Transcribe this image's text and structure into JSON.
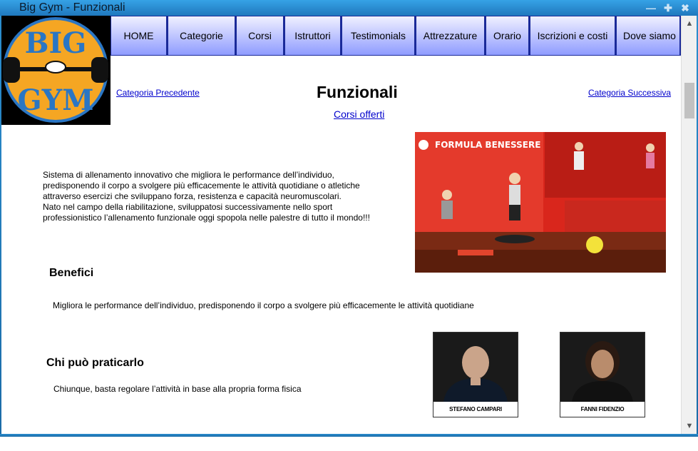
{
  "window": {
    "title": "Big Gym - Funzionali",
    "buttons": [
      "minimize",
      "maximize",
      "close"
    ]
  },
  "logo": {
    "alt": "BIG GYM logo",
    "top_text": "BIG",
    "bottom_text": "GYM"
  },
  "nav": [
    {
      "label": "HOME"
    },
    {
      "label": "Categorie"
    },
    {
      "label": "Corsi"
    },
    {
      "label": "Istruttori"
    },
    {
      "label": "Testimonials"
    },
    {
      "label": "Attrezzature"
    },
    {
      "label": "Orario"
    },
    {
      "label": "Iscrizioni e costi"
    },
    {
      "label": "Dove siamo"
    }
  ],
  "page": {
    "prev_link": "Categoria Precedente",
    "next_link": "Categoria Successiva",
    "title": "Funzionali",
    "courses_link": "Corsi offerti",
    "intro": [
      "Sistema di allenamento innovativo che migliora le performance dell’individuo,",
      "predisponendo il corpo a svolgere più efficacemente le attività quotidiane o atletiche",
      "attraverso esercizi che sviluppano forza, resistenza e capacità neuromuscolari.",
      "Nato nel campo della riabilitazione, sviluppatosi successivamente nello sport",
      "professionistico l’allenamento funzionale oggi spopola nelle palestre di tutto il mondo!!!"
    ],
    "photo_brand": "FORMULA BENESSERE",
    "benefici_heading": "Benefici",
    "benefici_text": "Migliora le performance dell’individuo, predisponendo il corpo a svolgere più efficacemente le attività quotidiane",
    "chi_heading": "Chi può praticarlo",
    "chi_text": "Chiunque, basta regolare l’attività in base alla propria forma fisica"
  },
  "instructors": [
    {
      "name": "STEFANO CAMPARI"
    },
    {
      "name": "FANNI FIDENZIO"
    }
  ],
  "colors": {
    "titlebar": "#1f78bd",
    "nav_top": "#f0f0ff",
    "nav_bottom": "#8f9cff",
    "logo_orange": "#f5a623",
    "logo_blue": "#2a76c4",
    "photo_red": "#d9261c"
  }
}
